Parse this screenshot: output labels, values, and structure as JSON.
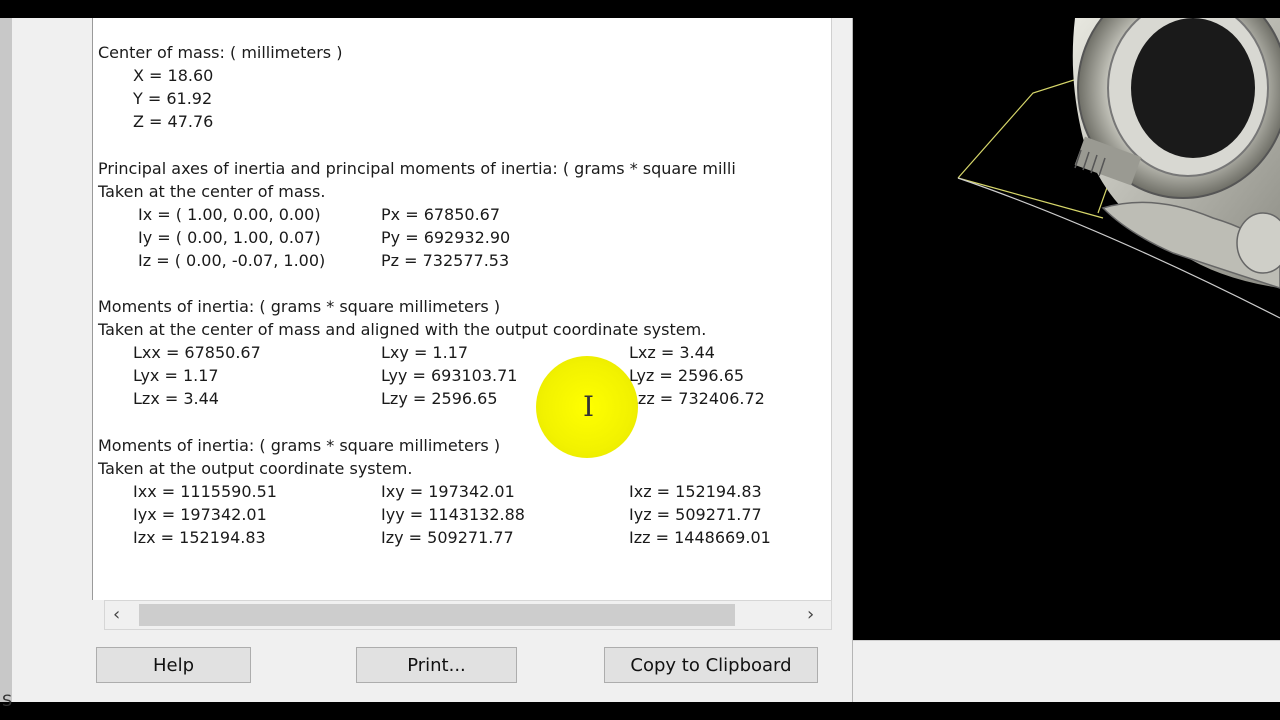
{
  "report": {
    "center_of_mass": {
      "heading": "Center of mass: ( millimeters )",
      "x": "X = 18.60",
      "y": "Y = 61.92",
      "z": "Z = 47.76"
    },
    "principal": {
      "heading": "Principal axes of inertia and principal moments of inertia: ( grams *  square milli",
      "subheading": "Taken at the center of mass.",
      "rows": [
        {
          "axis": "Ix = ( 1.00,  0.00,  0.00)",
          "moment": "Px = 67850.67"
        },
        {
          "axis": "Iy = ( 0.00,  1.00,  0.07)",
          "moment": "Py = 692932.90"
        },
        {
          "axis": "Iz = ( 0.00, -0.07,  1.00)",
          "moment": "Pz = 732577.53"
        }
      ]
    },
    "moments_center": {
      "heading": "Moments of inertia: ( grams *  square millimeters )",
      "subheading": "Taken at the center of mass and aligned with the output coordinate system.",
      "rows": [
        [
          "Lxx = 67850.67",
          "Lxy = 1.17",
          "Lxz = 3.44"
        ],
        [
          "Lyx = 1.17",
          "Lyy = 693103.71",
          "Lyz = 2596.65"
        ],
        [
          "Lzx = 3.44",
          "Lzy = 2596.65",
          "Lzz = 732406.72"
        ]
      ]
    },
    "moments_output": {
      "heading": "Moments of inertia: ( grams *  square millimeters )",
      "subheading": "Taken at the output coordinate system.",
      "rows": [
        [
          "Ixx = 1115590.51",
          "Ixy = 197342.01",
          "Ixz = 152194.83"
        ],
        [
          "Iyx = 197342.01",
          "Iyy = 1143132.88",
          "Iyz = 509271.77"
        ],
        [
          "Izx = 152194.83",
          "Izy = 509271.77",
          "Izz = 1448669.01"
        ]
      ]
    }
  },
  "scrollbar": {
    "left_arrow": "‹",
    "right_arrow": "›"
  },
  "buttons": {
    "help": "Help",
    "print": "Print...",
    "copy": "Copy to Clipboard"
  },
  "left_strip": {
    "letter": "S"
  },
  "colors": {
    "cursor_highlight": "#ffff00",
    "viewport_bg": "#000000",
    "dialog_bg": "#f0f0f0"
  }
}
